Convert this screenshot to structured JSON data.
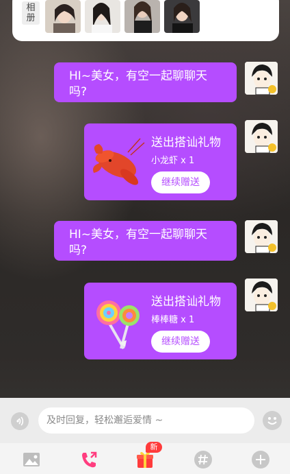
{
  "album": {
    "label_line1": "相",
    "label_line2": "册",
    "photos": [
      "album-photo-1",
      "album-photo-2",
      "album-photo-3",
      "album-photo-4"
    ]
  },
  "messages": [
    {
      "type": "text",
      "text_line1": "HI~美女，有空一起聊聊天",
      "text_line2": "吗?"
    },
    {
      "type": "gift",
      "title": "送出搭讪礼物",
      "gift_name": "小龙虾 x 1",
      "button": "继续赠送",
      "gift_icon": "crayfish-icon"
    },
    {
      "type": "text",
      "text_line1": "HI~美女，有空一起聊聊天",
      "text_line2": "吗?"
    },
    {
      "type": "gift",
      "title": "送出搭讪礼物",
      "gift_name": "棒棒糖 x 1",
      "button": "继续赠送",
      "gift_icon": "lollipop-icon"
    }
  ],
  "input": {
    "placeholder": "及时回复，轻松邂逅爱情 ~",
    "value": ""
  },
  "toolbar": {
    "new_badge": "新",
    "items": [
      "image-icon",
      "call-icon",
      "gift-icon",
      "hashtag-icon",
      "plus-icon"
    ]
  },
  "colors": {
    "bubble": "#b54dff",
    "badge": "#ff3b3b",
    "call_icon": "#ff3d7f"
  }
}
